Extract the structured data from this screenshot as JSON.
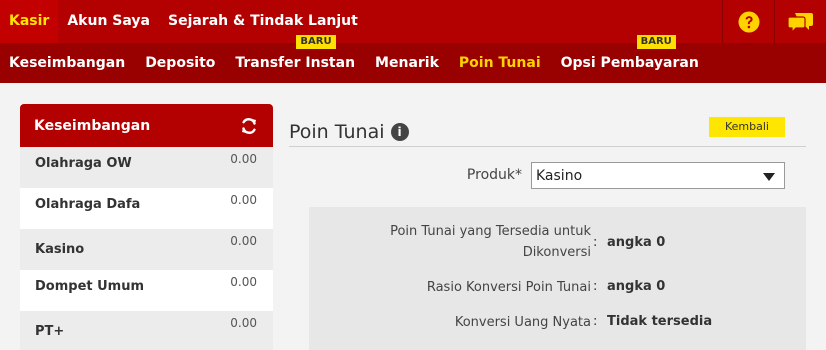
{
  "topnav": {
    "tabs": [
      {
        "label": "Kasir",
        "active": true
      },
      {
        "label": "Akun Saya",
        "active": false
      },
      {
        "label": "Sejarah & Tindak Lanjut",
        "active": false
      }
    ],
    "icons": [
      "help-icon",
      "chat-icon"
    ]
  },
  "subnav": {
    "items": [
      {
        "label": "Keseimbangan",
        "active": false,
        "badge": ""
      },
      {
        "label": "Deposito",
        "active": false,
        "badge": ""
      },
      {
        "label": "Transfer Instan",
        "active": false,
        "badge": "BARU"
      },
      {
        "label": "Menarik",
        "active": false,
        "badge": ""
      },
      {
        "label": "Poin Tunai",
        "active": true,
        "badge": ""
      },
      {
        "label": "Opsi Pembayaran",
        "active": false,
        "badge": "BARU"
      }
    ]
  },
  "balance": {
    "title": "Keseimbangan",
    "rows": [
      {
        "name": "Olahraga OW",
        "amount": "0.00"
      },
      {
        "name": "Olahraga Dafa",
        "amount": "0.00"
      },
      {
        "name": "Kasino",
        "amount": "0.00"
      },
      {
        "name": "Dompet Umum",
        "amount": "0.00"
      },
      {
        "name": "PT+",
        "amount": "0.00"
      }
    ]
  },
  "main": {
    "title": "Poin Tunai",
    "back_label": "Kembali",
    "product_label": "Produk*",
    "product_value": "Kasino",
    "info": [
      {
        "label": "Poin Tunai yang Tersedia untuk Dikonversi",
        "value": "angka 0"
      },
      {
        "label": "Rasio Konversi Poin Tunai",
        "value": "angka 0"
      },
      {
        "label": "Konversi Uang Nyata",
        "value": "Tidak tersedia"
      }
    ]
  },
  "colors": {
    "primary": "#b30000",
    "subnav": "#990000",
    "accent": "#ffe600"
  }
}
